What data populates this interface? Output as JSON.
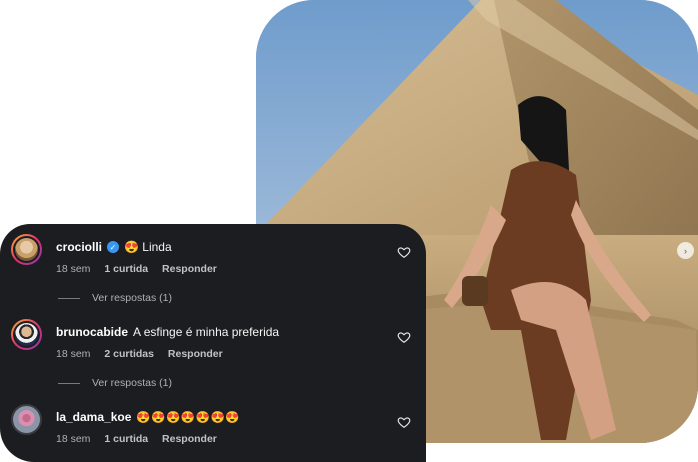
{
  "post": {
    "image_description_icon": "pyramid-photo",
    "carousel_indicator": "›"
  },
  "comments": [
    {
      "username": "crociolli",
      "verified": true,
      "text": "😍 Linda",
      "time": "18 sem",
      "likes": "1 curtida",
      "reply_label": "Responder",
      "view_replies": "Ver respostas (1)"
    },
    {
      "username": "brunocabide",
      "verified": false,
      "text": "A esfinge é minha preferida",
      "time": "18 sem",
      "likes": "2 curtidas",
      "reply_label": "Responder",
      "view_replies": "Ver respostas (1)"
    },
    {
      "username": "la_dama_koe",
      "verified": false,
      "text": "😍😍😍😍😍😍😍",
      "time": "18 sem",
      "likes": "1 curtida",
      "reply_label": "Responder"
    }
  ],
  "colors": {
    "panel_bg": "#1c1d21",
    "verified_blue": "#3897f0"
  }
}
